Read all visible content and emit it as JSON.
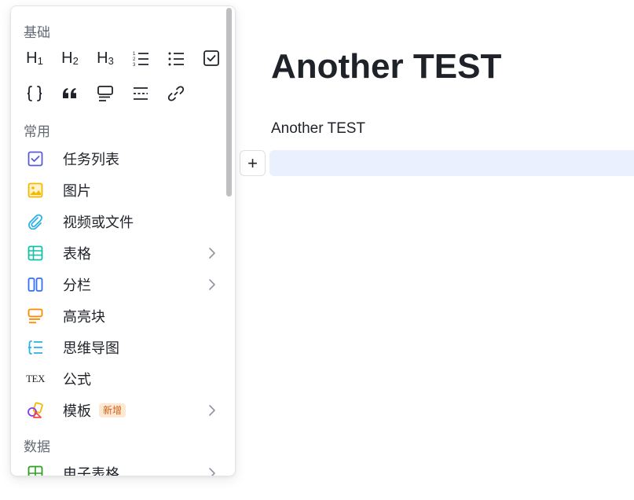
{
  "document": {
    "title": "Another TEST",
    "paragraph": "Another TEST",
    "add_button": "+"
  },
  "menu": {
    "basic": {
      "label": "基础",
      "headings": [
        {
          "main": "H",
          "sub": "1"
        },
        {
          "main": "H",
          "sub": "2"
        },
        {
          "main": "H",
          "sub": "3"
        }
      ],
      "tools": [
        "ordered-list-icon",
        "bullet-list-icon",
        "checkbox-icon",
        "code-block-icon",
        "quote-icon",
        "callout-icon",
        "divider-icon",
        "link-icon"
      ]
    },
    "common": {
      "label": "常用",
      "items": [
        {
          "label": "任务列表",
          "icon": "task-list-icon",
          "color": "#5b5bd6",
          "submenu": false
        },
        {
          "label": "图片",
          "icon": "image-icon",
          "color": "#f5b800",
          "submenu": false
        },
        {
          "label": "视频或文件",
          "icon": "attachment-icon",
          "color": "#2bb3e8",
          "submenu": false
        },
        {
          "label": "表格",
          "icon": "table-icon",
          "color": "#14c0a8",
          "submenu": true
        },
        {
          "label": "分栏",
          "icon": "columns-icon",
          "color": "#3370ff",
          "submenu": true
        },
        {
          "label": "高亮块",
          "icon": "highlight-block-icon",
          "color": "#ff8800",
          "submenu": false
        },
        {
          "label": "思维导图",
          "icon": "mindmap-icon",
          "color": "#2bb3e8",
          "submenu": false
        },
        {
          "label": "公式",
          "icon": "tex-icon",
          "color": "#1f2329",
          "submenu": false
        },
        {
          "label": "模板",
          "icon": "template-icon",
          "color": "#7f3bf5",
          "submenu": true,
          "badge": "新增"
        }
      ]
    },
    "data": {
      "label": "数据",
      "items": [
        {
          "label": "电子表格",
          "icon": "spreadsheet-icon",
          "color": "#2ea121",
          "submenu": true
        }
      ]
    },
    "tex_text": "TEX"
  }
}
